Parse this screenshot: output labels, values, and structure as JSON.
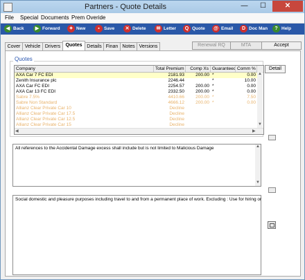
{
  "window": {
    "title": "Partners - Quote Details"
  },
  "window_controls": {
    "minimize": "—",
    "maximize": "☐",
    "close": "✕"
  },
  "menu": [
    "File",
    "Special",
    "Documents",
    "Prem Overide"
  ],
  "toolbar": [
    {
      "label": "Back",
      "icon": "back-icon",
      "color": "#3a8a2e"
    },
    {
      "label": "Forward",
      "icon": "forward-icon",
      "color": "#3a8a2e"
    },
    {
      "label": "New",
      "icon": "new-icon",
      "color": "#cc2f2f"
    },
    {
      "label": "Save",
      "icon": "save-icon",
      "color": "#cc2f2f"
    },
    {
      "label": "Delete",
      "icon": "delete-icon",
      "color": "#cc2f2f"
    },
    {
      "label": "Letter",
      "icon": "letter-icon",
      "color": "#cc2f2f"
    },
    {
      "label": "Quote",
      "icon": "quote-icon",
      "color": "#cc2f2f"
    },
    {
      "label": "Email",
      "icon": "email-icon",
      "color": "#cc2f2f"
    },
    {
      "label": "Doc Man",
      "icon": "doc-man-icon",
      "color": "#cc2f2f"
    },
    {
      "label": "Help",
      "icon": "help-icon",
      "color": "#3a8a2e"
    }
  ],
  "tabs": [
    "Cover",
    "Vehicle",
    "Drivers",
    "Quotes",
    "Details",
    "Finan",
    "Notes",
    "Versions"
  ],
  "active_tab": "Quotes",
  "right_buttons": [
    {
      "label": "Renewal RQ",
      "enabled": false
    },
    {
      "label": "MTA",
      "enabled": false
    },
    {
      "label": "Accept",
      "enabled": true
    }
  ],
  "quotes": {
    "group_label": "Quotes",
    "columns": [
      "Company",
      "Total Premium",
      "Comp Xs",
      "Guaranteed",
      "Comm %"
    ],
    "rows": [
      {
        "company": "AXA Car 7 FC EDI",
        "premium": "2181.93",
        "comp_xs": "200.00",
        "guaranteed": "*",
        "comm": "0.00",
        "style": "selected"
      },
      {
        "company": "Zenith Insurance plc",
        "premium": "2246.44",
        "comp_xs": "",
        "guaranteed": "*",
        "comm": "10.00",
        "style": "normal"
      },
      {
        "company": "AXA Car FC EDI",
        "premium": "2254.57",
        "comp_xs": "200.00",
        "guaranteed": "*",
        "comm": "0.00",
        "style": "normal"
      },
      {
        "company": "AXA Car 13 FC EDI",
        "premium": "2332.50",
        "comp_xs": "200.00",
        "guaranteed": "*",
        "comm": "0.00",
        "style": "normal"
      },
      {
        "company": "Sabre 7.5%",
        "premium": "4410.66",
        "comp_xs": "200.00",
        "guaranteed": "*",
        "comm": "7.50",
        "style": "dim"
      },
      {
        "company": "Sabre Non Standard",
        "premium": "4666.12",
        "comp_xs": "200.00",
        "guaranteed": "*",
        "comm": "0.00",
        "style": "dim"
      },
      {
        "company": "Allianz Clear Private Car 10",
        "premium": "Decline",
        "comp_xs": "",
        "guaranteed": "",
        "comm": "",
        "style": "dim"
      },
      {
        "company": "Allianz Clear Private Car 17.5",
        "premium": "Decline",
        "comp_xs": "",
        "guaranteed": "",
        "comm": "",
        "style": "dim"
      },
      {
        "company": "Allianz Clear Private Car 12.5",
        "premium": "Decline",
        "comp_xs": "",
        "guaranteed": "",
        "comm": "",
        "style": "dim"
      },
      {
        "company": "Allianz Clear Private Car 15",
        "premium": "Decline",
        "comp_xs": "",
        "guaranteed": "",
        "comm": "",
        "style": "dim"
      }
    ],
    "detail_button": "Detail"
  },
  "notes": {
    "excess_text": "All references to the Accidental Damage excess shall include but is not limited to Malicious Damage",
    "usage_text": "Social domestic and pleasure purposes including travel to and from a permanent place of work. Excluding : Use for hiring or"
  },
  "colors": {
    "normal_text": "#000000",
    "dim_text": "#e8b26a",
    "selected_row": "#ffffc8",
    "toolbar": "#2a58a8",
    "group_label": "#2b57b0"
  }
}
